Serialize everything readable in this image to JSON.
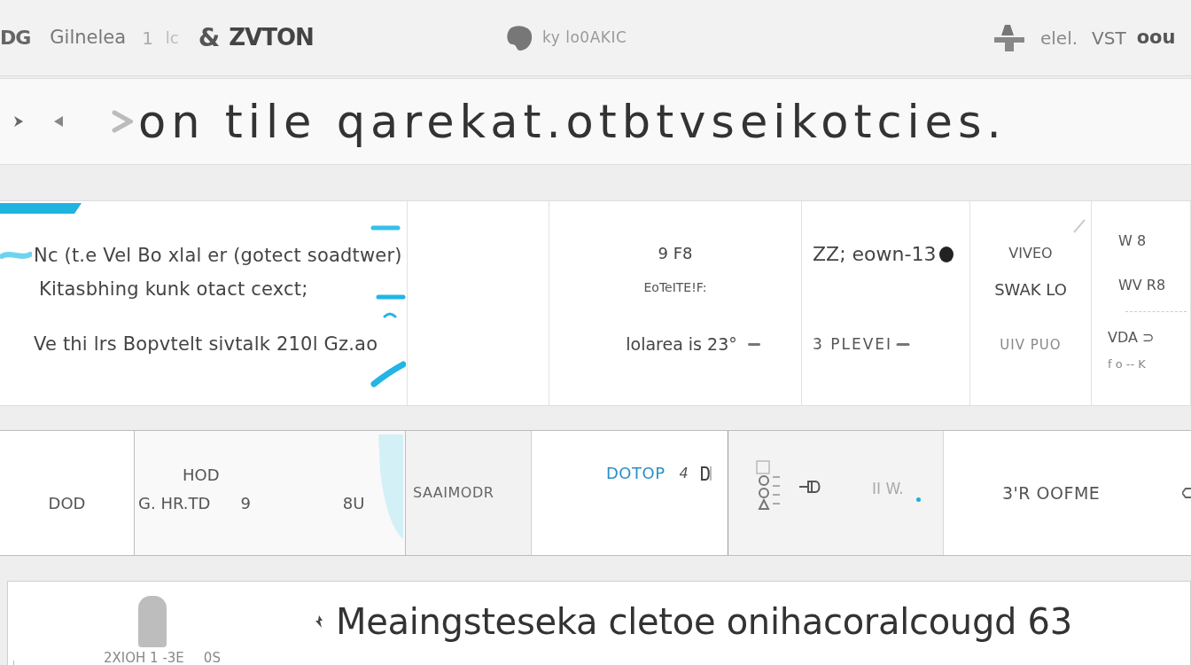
{
  "top_bar": {
    "nav_links": [
      "DG",
      "Gilnelea",
      "1",
      "lc"
    ],
    "brand": {
      "mark": "&",
      "name": "ZVTON"
    },
    "center_label": "ky lo0AKIC",
    "right_links": [
      "elel.",
      "VST"
    ],
    "account": "oou"
  },
  "header": {
    "title": "on tile qarekat.otbtvseikotcies."
  },
  "panels": [
    {
      "kind": "note",
      "lines": [
        "Nc (t.e Vel Bo xlal er (gotect soadtwer)",
        "Kitasbhing kunk otact cexct;",
        "Ve thi lrs Bopvtelt sivtalk 210l Gz.ao"
      ]
    },
    {
      "kind": "blank"
    },
    {
      "kind": "reading",
      "lines": [
        "9 F8",
        "EoTeITE!F:",
        "lolarea is 23°"
      ]
    },
    {
      "kind": "status",
      "lines": [
        "ZZ; eown-13",
        "3 PLEVEI"
      ]
    },
    {
      "kind": "list",
      "lines": [
        "VIVEO",
        "SWAK LO",
        "UIV PUO"
      ]
    },
    {
      "kind": "legend",
      "lines": [
        "W 8",
        "WV R8",
        "VDA ⊃",
        "f o -- K"
      ]
    }
  ],
  "tiles": [
    {
      "kind": "plain",
      "labels": [
        "DOD"
      ]
    },
    {
      "kind": "split",
      "labels": [
        "HOD",
        "G. HR.TD",
        "9",
        "8U"
      ]
    },
    {
      "kind": "shaded",
      "labels": [
        "SAAIMODR"
      ]
    },
    {
      "kind": "link",
      "labels": [
        "DOTOP",
        "4"
      ]
    },
    {
      "kind": "glyphs",
      "labels": [
        "II W."
      ]
    },
    {
      "kind": "action",
      "labels": [
        "3'R OOFME"
      ]
    }
  ],
  "footer_card": {
    "title": "Meaingsteseka cletoe onihacoralcougd 63",
    "caption": "2XIOH 1 -3E",
    "note": "0S"
  }
}
